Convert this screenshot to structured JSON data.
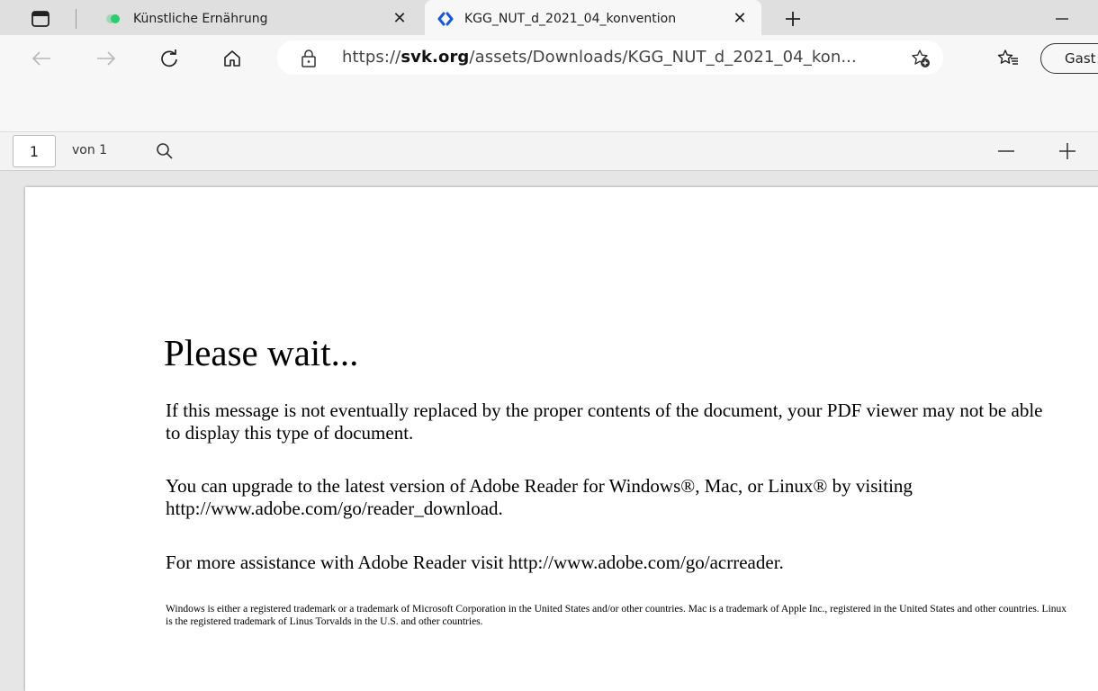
{
  "tabs": [
    {
      "title": "Künstliche Ernährung",
      "active": false
    },
    {
      "title": "KGG_NUT_d_2021_04_konvention",
      "active": true
    }
  ],
  "address_bar": {
    "url_prefix": "https://",
    "url_domain": "svk.org",
    "url_rest": "/assets/Downloads/KGG_NUT_d_2021_04_kon..."
  },
  "profile": {
    "label": "Gast"
  },
  "pdf_toolbar": {
    "page_number": "1",
    "page_of": "von 1"
  },
  "document": {
    "title": "Please wait...",
    "paragraph1": "If this message is not eventually replaced by the proper contents of the document, your PDF viewer may not be able to display this type of document.",
    "paragraph2": "You can upgrade to the latest version of Adobe Reader for Windows®, Mac, or Linux® by visiting  http://www.adobe.com/go/reader_download.",
    "paragraph3": "For more assistance with Adobe Reader visit  http://www.adobe.com/go/acrreader.",
    "footnote": "Windows is either a registered trademark or a trademark of Microsoft Corporation in the United States and/or other countries. Mac is a trademark of Apple Inc., registered in the United States and other countries. Linux is the registered trademark of Linus Torvalds in the U.S. and other countries."
  },
  "icons": [
    "tab-actions-icon",
    "tab-favicon-green",
    "tab-favicon-link",
    "close-icon",
    "new-tab-icon",
    "minimize-icon",
    "back-icon",
    "forward-icon",
    "refresh-icon",
    "home-icon",
    "site-info-icon",
    "add-favorite-icon",
    "favorites-icon",
    "search-icon",
    "zoom-out-icon",
    "zoom-in-icon"
  ],
  "colors": {
    "tab_strip": "#dfdfdf",
    "toolbar": "#f7f7f7",
    "favicon_green": "#2ecc71",
    "favicon_blue": "#1a56db"
  }
}
